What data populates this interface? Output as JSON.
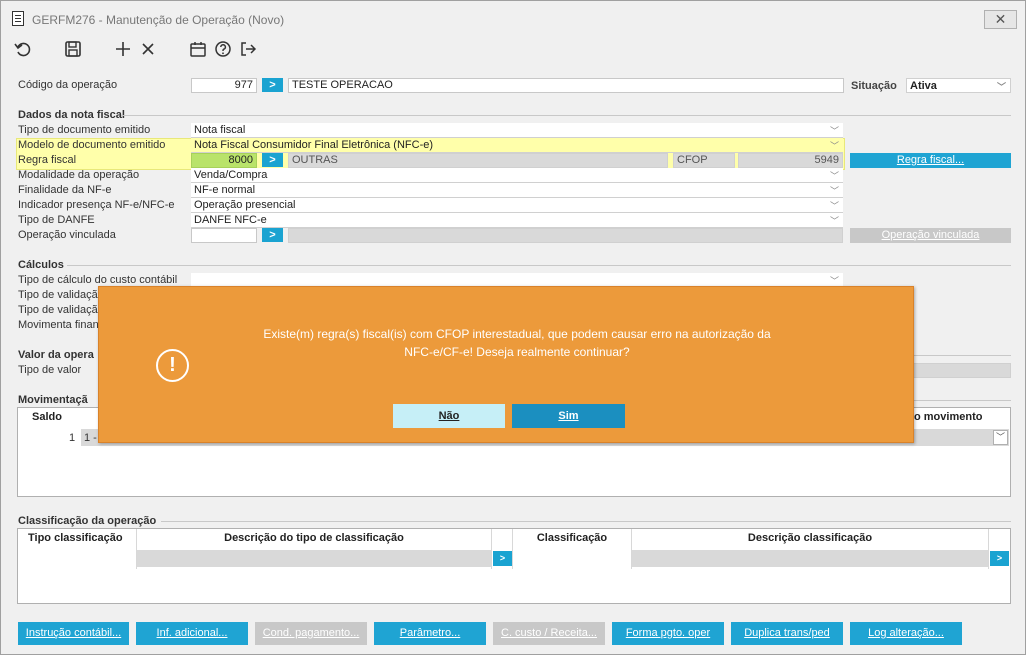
{
  "window": {
    "title": "GERFM276 - Manutenção de Operação (Novo)",
    "close_label": "✕"
  },
  "toolbar": {
    "icons": [
      "undo-icon",
      "save-icon",
      "add-icon",
      "cancel-icon",
      "calendar-icon",
      "help-icon",
      "exit-icon"
    ]
  },
  "header": {
    "codigo_label": "Código da operação",
    "codigo_value": "977",
    "codigo_desc": "TESTE OPERACAO",
    "situacao_label": "Situação",
    "situacao_value": "Ativa"
  },
  "dados_nota": {
    "title": "Dados da nota fiscal",
    "tipo_doc_label": "Tipo de documento emitido",
    "tipo_doc_value": "Nota fiscal",
    "modelo_label": "Modelo de documento emitido",
    "modelo_value": "Nota Fiscal Consumidor Final Eletrônica (NFC-e)",
    "regra_label": "Regra fiscal",
    "regra_value": "8000",
    "regra_desc": "OUTRAS",
    "cfop_label": "CFOP",
    "cfop_value": "5949",
    "regra_button": "Regra fiscal...",
    "modalidade_label": "Modalidade da operação",
    "modalidade_value": "Venda/Compra",
    "finalidade_label": "Finalidade da NF-e",
    "finalidade_value": "NF-e normal",
    "indicador_label": "Indicador presença NF-e/NFC-e",
    "indicador_value": "Operação presencial",
    "danfe_label": "Tipo de DANFE",
    "danfe_value": "DANFE NFC-e",
    "vinculada_label": "Operação vinculada",
    "vinculada_button": "Operação vinculada"
  },
  "calculos": {
    "title": "Cálculos",
    "custo_label": "Tipo de cálculo do custo contábil",
    "validacao1_label": "Tipo de validaçã",
    "validacao2_label": "Tipo de validaçã",
    "movimenta_label": "Movimenta finan"
  },
  "valor": {
    "title": "Valor da opera",
    "tipo_label": "Tipo de valor"
  },
  "movimentacao": {
    "title": "Movimentaçã",
    "col_saldo": "Saldo",
    "col_movimento": "o movimento",
    "row_num": "1",
    "row_text": "1 -"
  },
  "classificacao": {
    "title": "Classificação da operação",
    "col_tipo": "Tipo classificação",
    "col_desc_tipo": "Descrição do tipo de classificação",
    "col_class": "Classificação",
    "col_desc_class": "Descrição classificação",
    "go": ">"
  },
  "bottom_buttons": [
    "Instrução contábil...",
    "Inf. adicional...",
    "Cond. pagamento...",
    "Parâmetro...",
    "C. custo / Receita...",
    "Forma pgto. oper",
    "Duplica trans/ped",
    "Log alteração..."
  ],
  "dialog": {
    "message_line1": "Existe(m) regra(s) fiscal(is) com CFOP interestadual, que podem causar erro na autorização da",
    "message_line2": "NFC-e/CF-e! Deseja realmente continuar?",
    "icon": "!",
    "no_label": "Não",
    "yes_label": "Sim"
  },
  "colors": {
    "accent": "#1fa4d3",
    "dialog_bg": "#ec9a3b",
    "highlight_yellow": "#ffffaa",
    "field_green": "#b9e36a"
  }
}
